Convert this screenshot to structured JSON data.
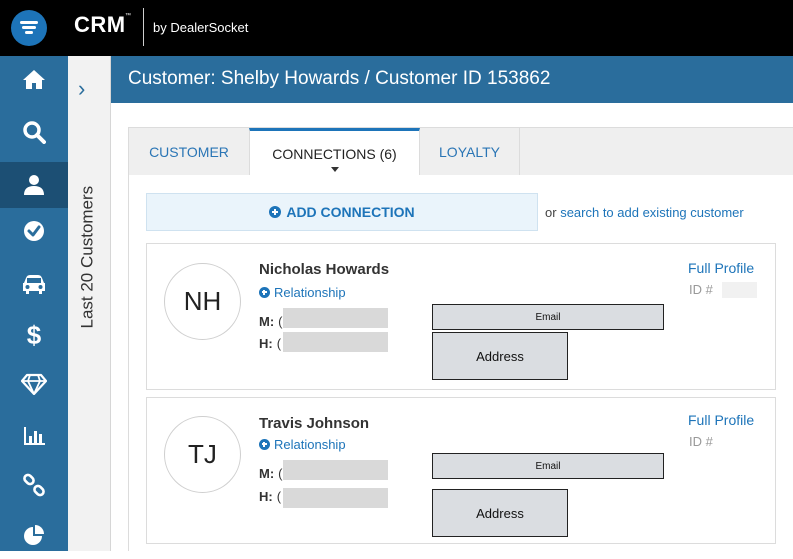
{
  "brand": {
    "name": "CRM",
    "trademark": "™",
    "byline": "by DealerSocket",
    "accent_color": "#1d74b9",
    "nav_color": "#2a6d9c"
  },
  "nav": {
    "items": [
      {
        "icon": "home-icon"
      },
      {
        "icon": "search-icon"
      },
      {
        "icon": "user-icon",
        "active": true
      },
      {
        "icon": "check-circle-icon"
      },
      {
        "icon": "car-icon"
      },
      {
        "icon": "dollar-icon",
        "glyph": "$"
      },
      {
        "icon": "diamond-icon"
      },
      {
        "icon": "bar-chart-icon"
      },
      {
        "icon": "link-icon"
      },
      {
        "icon": "pie-chart-icon"
      }
    ]
  },
  "side_panel": {
    "arrow": "›",
    "label": "Last 20 Customers"
  },
  "header": {
    "title": "Customer: Shelby Howards / Customer ID 153862"
  },
  "tabs": [
    {
      "label": "CUSTOMER"
    },
    {
      "label": "CONNECTIONS (6)",
      "active": true
    },
    {
      "label": "LOYALTY"
    }
  ],
  "add_connection": {
    "label": "ADD CONNECTION",
    "or_text": "or",
    "search_link": "search to add existing customer"
  },
  "connections": [
    {
      "initials": "NH",
      "name": "Nicholas Howards",
      "relationship_label": "Relationship",
      "phone_m_label": "M:",
      "phone_m_value": "(",
      "phone_h_label": "H:",
      "phone_h_value": "(",
      "email_label": "Email",
      "address_label": "Address",
      "profile_link": "Full Profile",
      "id_label": "ID #"
    },
    {
      "initials": "TJ",
      "name": "Travis Johnson",
      "relationship_label": "Relationship",
      "phone_m_label": "M:",
      "phone_m_value": "(",
      "phone_h_label": "H:",
      "phone_h_value": "(",
      "email_label": "Email",
      "address_label": "Address",
      "profile_link": "Full Profile",
      "id_label": "ID #"
    }
  ]
}
